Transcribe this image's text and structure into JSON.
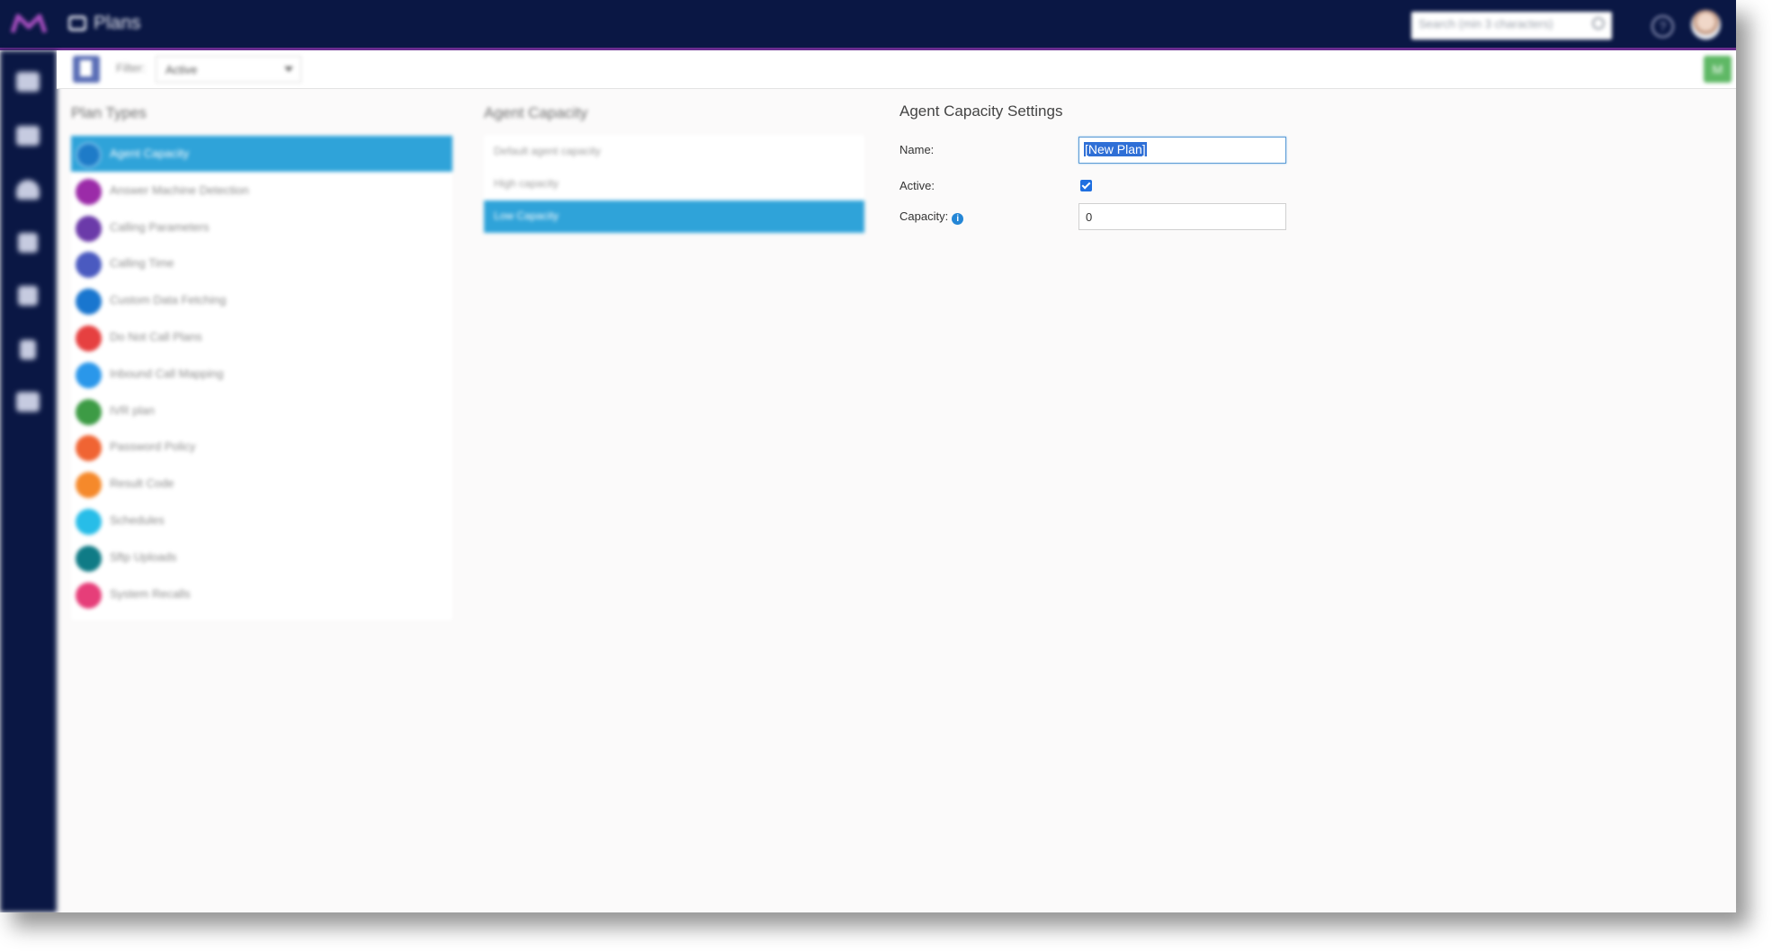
{
  "header": {
    "app_title": "Plans",
    "search_placeholder": "Search (min 3 characters)",
    "help_label": "?"
  },
  "toolbar": {
    "filter_label": "Filter:",
    "filter_value": "Active",
    "corner_button_label": "M"
  },
  "plan_types": {
    "title": "Plan Types",
    "items": [
      {
        "label": "Agent Capacity",
        "color": "#1e7bc8",
        "selected": true
      },
      {
        "label": "Answer Machine Detection",
        "color": "#9b2ba8",
        "selected": false
      },
      {
        "label": "Calling Parameters",
        "color": "#6b3aa9",
        "selected": false
      },
      {
        "label": "Calling Time",
        "color": "#4a5ac0",
        "selected": false
      },
      {
        "label": "Custom Data Fetching",
        "color": "#1976cf",
        "selected": false
      },
      {
        "label": "Do Not Call Plans",
        "color": "#e64040",
        "selected": false
      },
      {
        "label": "Inbound Call Mapping",
        "color": "#2a97ea",
        "selected": false
      },
      {
        "label": "IVR plan",
        "color": "#3d9b45",
        "selected": false
      },
      {
        "label": "Password Policy",
        "color": "#f06433",
        "selected": false
      },
      {
        "label": "Result Code",
        "color": "#f5892b",
        "selected": false
      },
      {
        "label": "Schedules",
        "color": "#27bde8",
        "selected": false
      },
      {
        "label": "Sftp Uploads",
        "color": "#0f7b86",
        "selected": false
      },
      {
        "label": "System Recalls",
        "color": "#e63e79",
        "selected": false
      }
    ]
  },
  "agent_capacity": {
    "title": "Agent Capacity",
    "items": [
      {
        "label": "Default agent capacity",
        "selected": false
      },
      {
        "label": "High capacity",
        "selected": false
      },
      {
        "label": "Low Capacity",
        "selected": true
      }
    ]
  },
  "settings": {
    "title": "Agent Capacity Settings",
    "name_label": "Name:",
    "name_value": "[New Plan]",
    "active_label": "Active:",
    "active_checked": true,
    "capacity_label": "Capacity:",
    "capacity_value": "0",
    "info_glyph": "i"
  }
}
